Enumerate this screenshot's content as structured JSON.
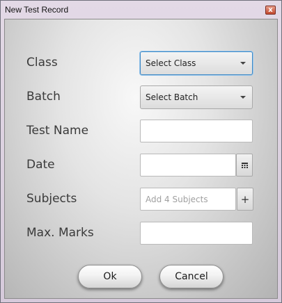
{
  "window": {
    "title": "New Test Record",
    "close_glyph": "x"
  },
  "form": {
    "class_label": "Class",
    "class_selected": "Select Class",
    "batch_label": "Batch",
    "batch_selected": "Select Batch",
    "test_name_label": "Test Name",
    "test_name_value": "",
    "date_label": "Date",
    "date_value": "",
    "subjects_label": "Subjects",
    "subjects_placeholder": "Add 4 Subjects",
    "subjects_add_glyph": "+",
    "max_marks_label": "Max. Marks",
    "max_marks_value": ""
  },
  "buttons": {
    "ok_label": "Ok",
    "cancel_label": "Cancel"
  },
  "icons": {
    "date_picker": "calendar-icon",
    "dropdown": "chevron-down-icon",
    "add": "plus-icon",
    "close": "close-icon"
  },
  "colors": {
    "focus_ring": "#3b87c5",
    "close_button": "#c2492f"
  }
}
